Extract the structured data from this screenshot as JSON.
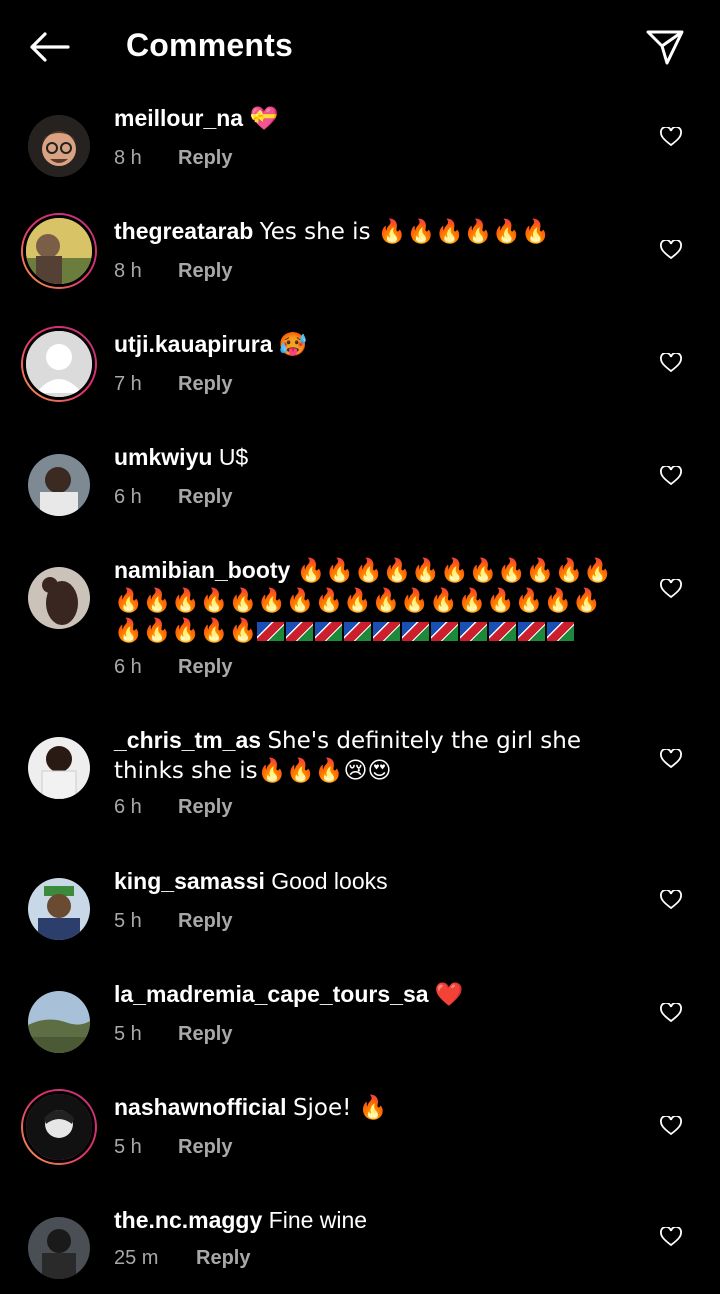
{
  "header": {
    "title": "Comments"
  },
  "reply_label": "Reply",
  "comments": [
    {
      "username": "meillour_na",
      "text": "💝",
      "time": "8 h"
    },
    {
      "username": "thegreatarab",
      "text": "Yes she is 🔥🔥🔥🔥🔥🔥",
      "time": "8 h"
    },
    {
      "username": "utji.kauapirura",
      "text": "🥵",
      "time": "7 h"
    },
    {
      "username": "umkwiyu",
      "text": "U$",
      "time": "6 h"
    },
    {
      "username": "namibian_booty",
      "text": "🔥🔥🔥🔥🔥🔥🔥🔥🔥🔥🔥🔥🔥🔥🔥🔥🔥🔥🔥🔥🔥🔥🔥🔥🔥🔥🔥🔥🔥🔥🔥🔥🔥",
      "flags": 11,
      "time": "6 h"
    },
    {
      "username": "_chris_tm_as",
      "text": "She's definitely the girl she thinks she is🔥🔥🔥😢😍",
      "time": "6 h"
    },
    {
      "username": "king_samassi",
      "text": "Good looks",
      "time": "5 h"
    },
    {
      "username": "la_madremia_cape_tours_sa",
      "text": "❤️",
      "time": "5 h"
    },
    {
      "username": "nashawnofficial",
      "text": "Sjoe! 🔥",
      "time": "5 h"
    },
    {
      "username": "the.nc.maggy",
      "text": "Fine wine",
      "time": "25 m"
    }
  ]
}
